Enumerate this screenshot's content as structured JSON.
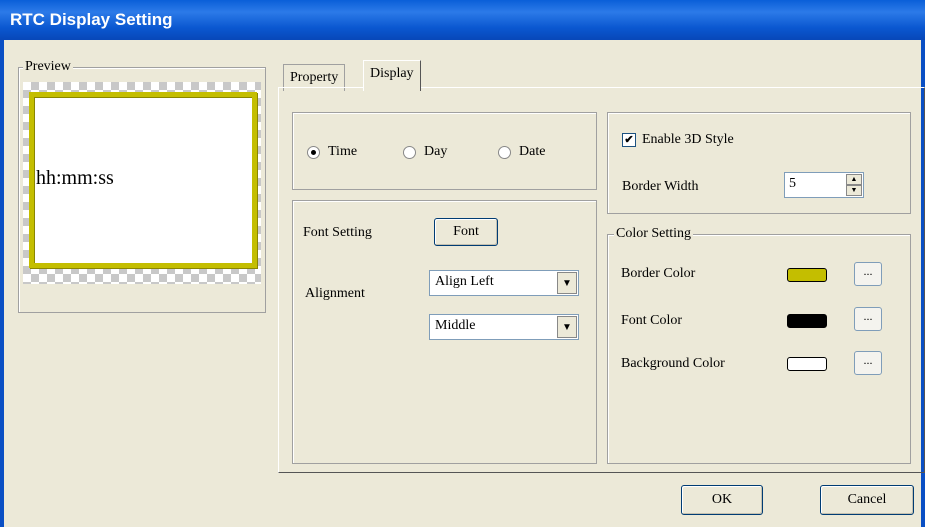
{
  "window": {
    "title": "RTC Display Setting"
  },
  "preview": {
    "group_title": "Preview",
    "sample_text": "hh:mm:ss"
  },
  "tabs": [
    {
      "label": "Property"
    },
    {
      "label": "Display",
      "active": true
    }
  ],
  "format": {
    "options": [
      {
        "label": "Time",
        "selected": true
      },
      {
        "label": "Day",
        "selected": false
      },
      {
        "label": "Date",
        "selected": false
      }
    ]
  },
  "font": {
    "font_setting_label": "Font Setting",
    "font_button": "Font",
    "alignment_label": "Alignment",
    "horizontal_value": "Align Left",
    "vertical_value": "Middle"
  },
  "style3d": {
    "enable_label": "Enable 3D Style",
    "enabled": true,
    "border_width_label": "Border Width",
    "border_width_value": "5"
  },
  "colors": {
    "group_title": "Color Setting",
    "rows": [
      {
        "label": "Border Color",
        "color": "#C4BE00",
        "button": "..."
      },
      {
        "label": "Font Color",
        "color": "#000000",
        "button": "..."
      },
      {
        "label": "Background Color",
        "color": "#FFFFFF",
        "button": "..."
      }
    ]
  },
  "footer": {
    "ok_label": "OK",
    "cancel_label": "Cancel"
  },
  "theme": {
    "titlebar": "#0A57D0",
    "face": "#ECE9D8"
  }
}
